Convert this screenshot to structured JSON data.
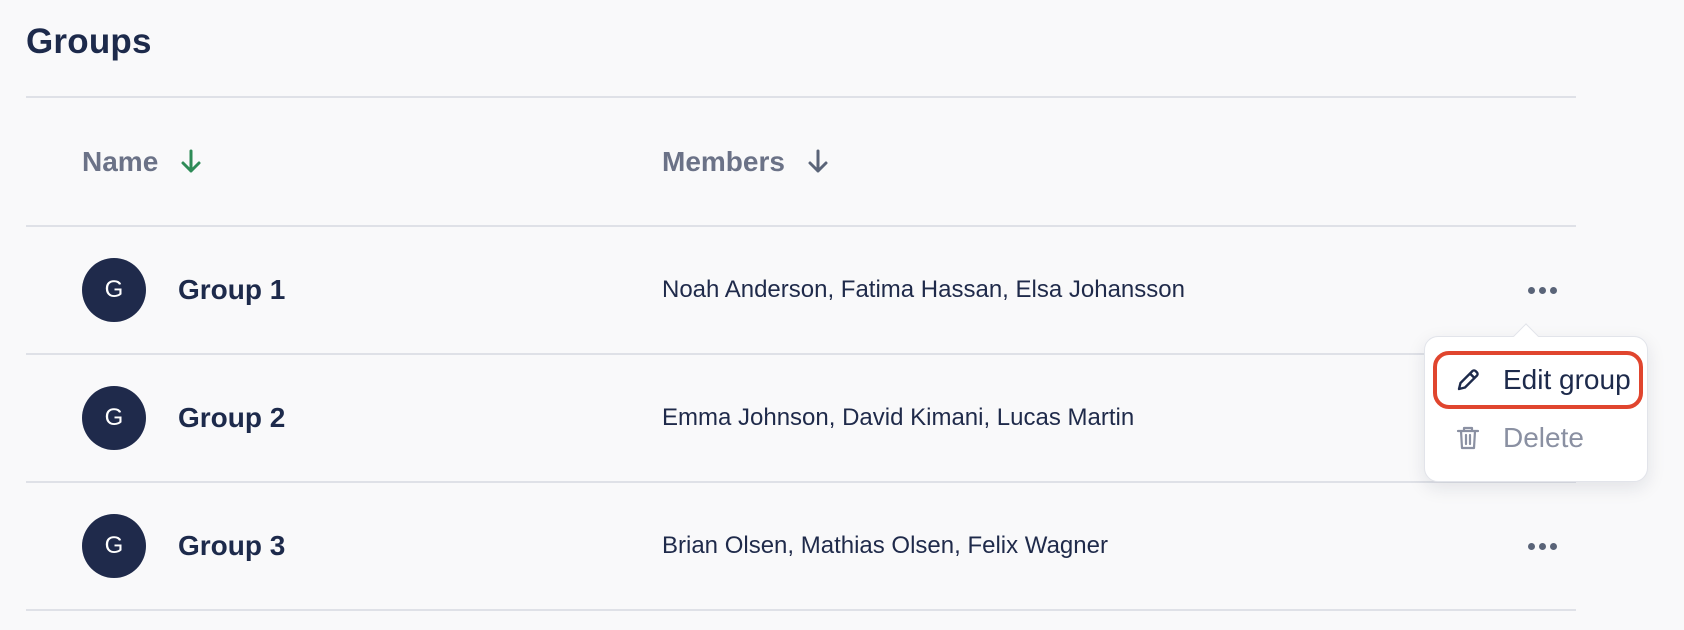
{
  "page": {
    "title": "Groups"
  },
  "table": {
    "columns": [
      {
        "label": "Name",
        "sort_icon": "arrow-down-icon",
        "sort_color": "#2e8b57"
      },
      {
        "label": "Members",
        "sort_icon": "arrow-down-icon",
        "sort_color": "#5a6478"
      }
    ],
    "rows": [
      {
        "avatar": "G",
        "name": "Group 1",
        "members": "Noah Anderson, Fatima Hassan, Elsa Johansson",
        "actions_icon": "more-horizontal-icon"
      },
      {
        "avatar": "G",
        "name": "Group 2",
        "members": "Emma Johnson, David Kimani, Lucas Martin",
        "actions_icon": "more-horizontal-icon"
      },
      {
        "avatar": "G",
        "name": "Group 3",
        "members": "Brian Olsen, Mathias Olsen, Felix Wagner",
        "actions_icon": "more-horizontal-icon"
      }
    ]
  },
  "context_menu": {
    "items": [
      {
        "label": "Edit group",
        "icon": "pencil-icon",
        "highlighted": true
      },
      {
        "label": "Delete",
        "icon": "trash-icon",
        "disabled": true
      }
    ]
  },
  "colors": {
    "avatar_bg": "#1f2a4b",
    "highlight_border": "#e0452e",
    "divider": "#dfe1e7"
  }
}
